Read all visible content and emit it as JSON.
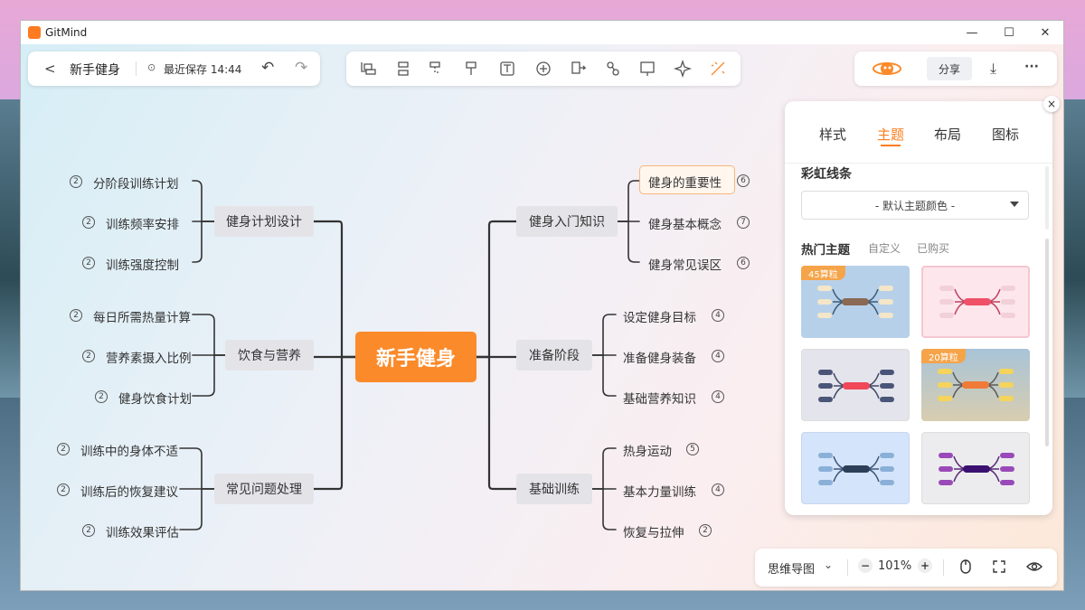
{
  "window": {
    "app_name": "GitMind",
    "min": "—",
    "max": "☐",
    "close": "✕"
  },
  "header": {
    "back": "<",
    "title": "新手健身",
    "save_status": "最近保存 14:44",
    "undo": "↶",
    "redo": "↷"
  },
  "toolbar_icons": [
    "insert-child-icon",
    "insert-sibling-icon",
    "insert-parent-icon",
    "format-painter-icon",
    "text-box-icon",
    "add-icon",
    "relation-icon",
    "link-icon",
    "summary-icon",
    "sparkle-icon",
    "magic-wand-icon"
  ],
  "top_right": {
    "share": "分享",
    "download": "⤓",
    "more": "···"
  },
  "mindmap": {
    "center": "新手健身",
    "left": [
      {
        "label": "健身计划设计",
        "children": [
          {
            "text": "分阶段训练计划",
            "count": "2"
          },
          {
            "text": "训练频率安排",
            "count": "2"
          },
          {
            "text": "训练强度控制",
            "count": "2"
          }
        ]
      },
      {
        "label": "饮食与营养",
        "children": [
          {
            "text": "每日所需热量计算",
            "count": "2"
          },
          {
            "text": "营养素摄入比例",
            "count": "2"
          },
          {
            "text": "健身饮食计划",
            "count": "2"
          }
        ]
      },
      {
        "label": "常见问题处理",
        "children": [
          {
            "text": "训练中的身体不适",
            "count": "2"
          },
          {
            "text": "训练后的恢复建议",
            "count": "2"
          },
          {
            "text": "训练效果评估",
            "count": "2"
          }
        ]
      }
    ],
    "right": [
      {
        "label": "健身入门知识",
        "children": [
          {
            "text": "健身的重要性",
            "count": "6"
          },
          {
            "text": "健身基本概念",
            "count": "7"
          },
          {
            "text": "健身常见误区",
            "count": "6"
          }
        ]
      },
      {
        "label": "准备阶段",
        "children": [
          {
            "text": "设定健身目标",
            "count": "4"
          },
          {
            "text": "准备健身装备",
            "count": "4"
          },
          {
            "text": "基础营养知识",
            "count": "4"
          }
        ]
      },
      {
        "label": "基础训练",
        "children": [
          {
            "text": "热身运动",
            "count": "5"
          },
          {
            "text": "基本力量训练",
            "count": "4"
          },
          {
            "text": "恢复与拉伸",
            "count": "2"
          }
        ]
      }
    ]
  },
  "side_panel": {
    "close": "×",
    "tabs": [
      "样式",
      "主题",
      "布局",
      "图标"
    ],
    "active_tab": "主题",
    "section_title": "彩虹线条",
    "dropdown_value": "- 默认主题颜色 -",
    "themes_title": "热门主题",
    "theme_tabs": [
      "自定义",
      "已购买"
    ],
    "badges": {
      "first": "45算粒",
      "fourth": "20算粒"
    }
  },
  "bottom_bar": {
    "view_mode": "思维导图",
    "zoom_out": "−",
    "zoom": "101%",
    "zoom_in": "+"
  },
  "colors": {
    "accent": "#fb8a2a"
  }
}
